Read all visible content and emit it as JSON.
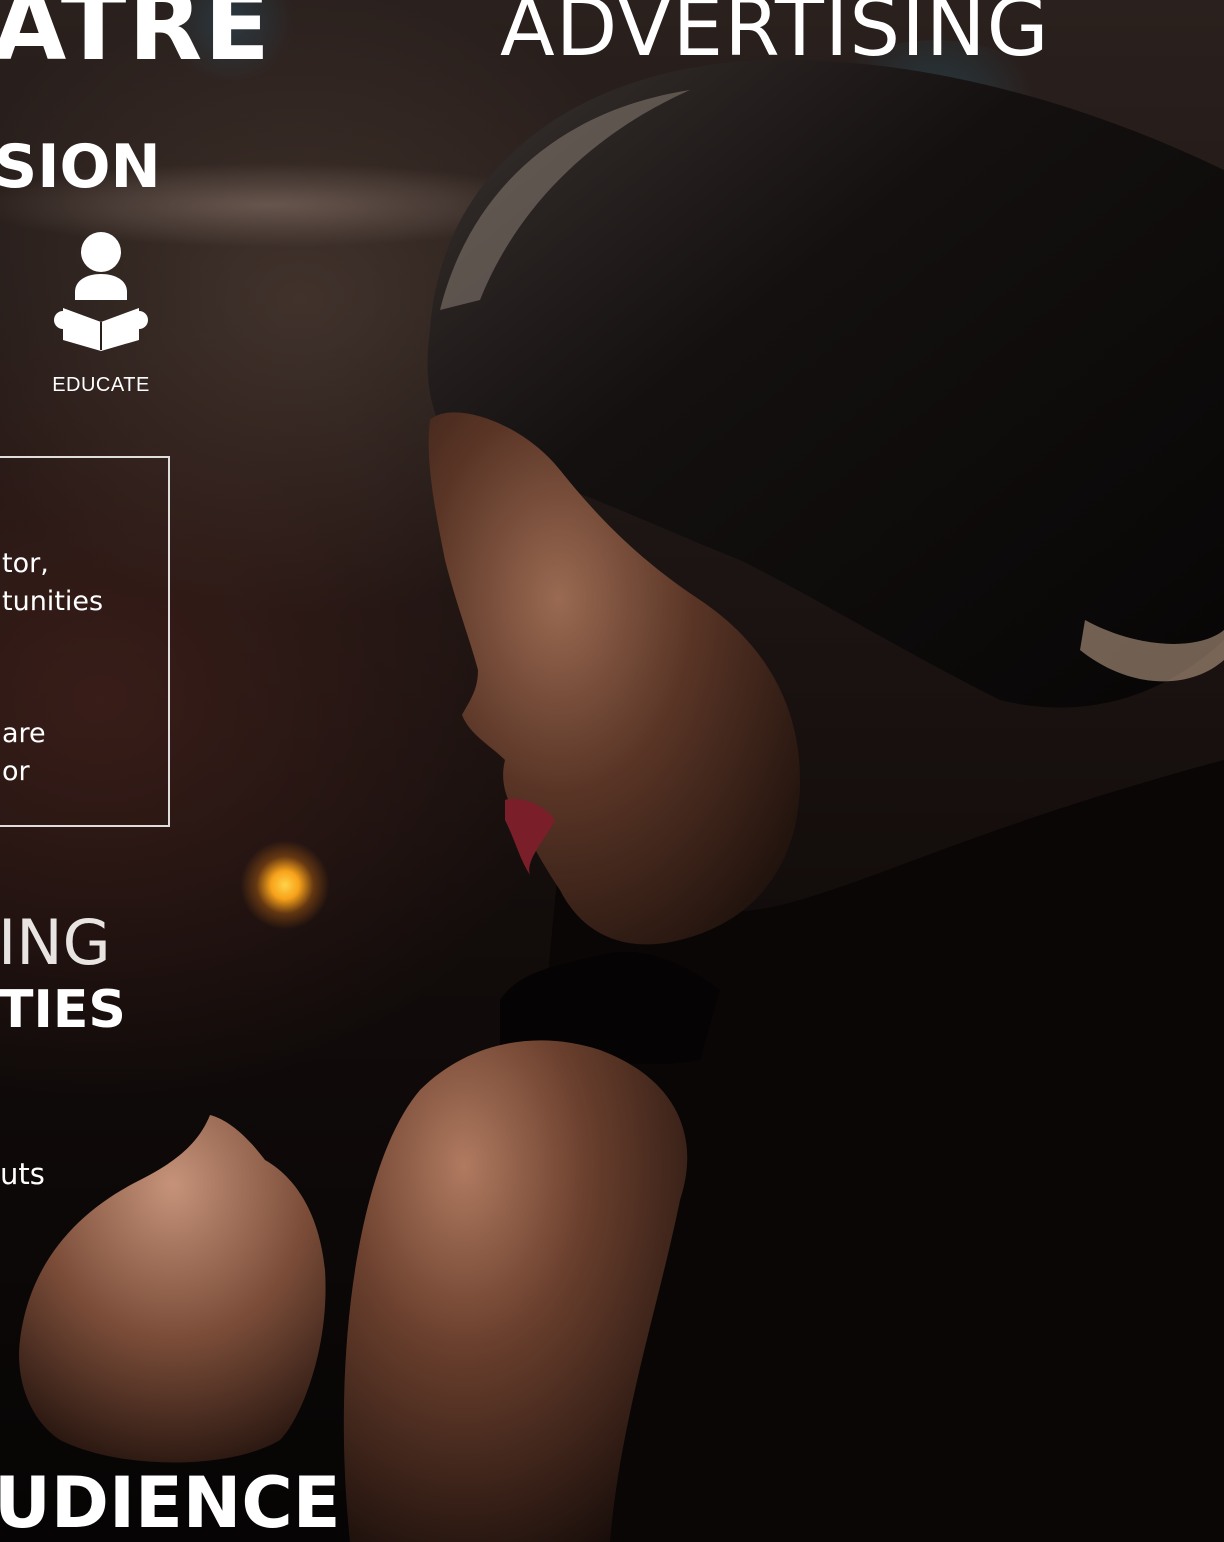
{
  "header": {
    "left_title_fragment": "ATRE",
    "right_title": "ADVERTISING"
  },
  "mission": {
    "heading_fragment": "SION",
    "educate_label": "EDUCATE",
    "educate_icon": "person-reading-icon"
  },
  "info_box": {
    "lines": [
      "tor,",
      "tunities",
      "are",
      "or"
    ]
  },
  "opportunities": {
    "line_1": "ING",
    "line_2": "TIES",
    "body_fragment": "uts"
  },
  "audience": {
    "heading_fragment": "UDIENCE"
  },
  "colors": {
    "text": "#ffffff",
    "background": "#120c0b",
    "bokeh_amber": "#f7a21a",
    "bokeh_teal": "#285a6e"
  }
}
